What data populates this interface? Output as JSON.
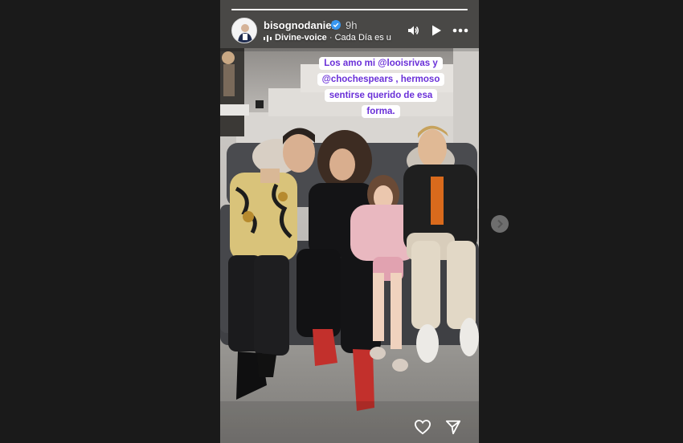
{
  "story": {
    "username": "bisognodaniel",
    "time_ago": "9h",
    "music_artist": "Divine-voice",
    "music_separator": "·",
    "music_title": "Cada Día es u",
    "caption_lines": [
      "Los  amo mi @looisrivas y",
      "@chochespears , hermoso",
      "sentirse querido de esa",
      "forma."
    ],
    "progress": 1.0
  },
  "icons": {
    "verified": "verified-badge-icon",
    "audio": "speaker-icon",
    "play": "play-icon",
    "more": "more-horizontal-icon",
    "like": "heart-icon",
    "share": "paper-plane-icon",
    "next": "chevron-right-icon",
    "music": "music-bars-icon"
  },
  "colors": {
    "background": "#1a1a1a",
    "caption_text": "#6a30d8",
    "caption_bg": "#ffffff",
    "verified": "#3897f0"
  }
}
